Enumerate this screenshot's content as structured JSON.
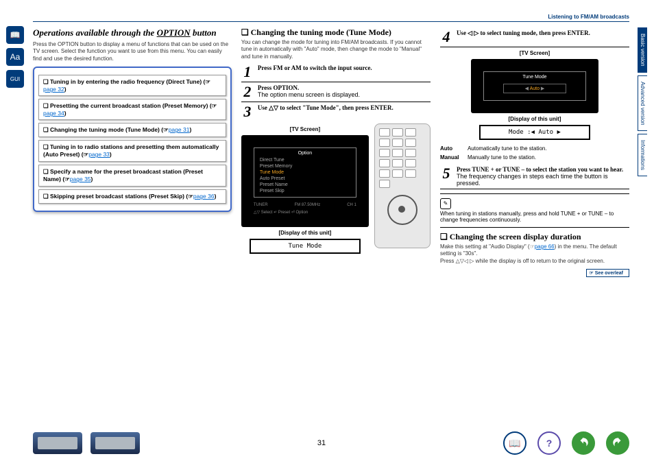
{
  "breadcrumb": "Listening to FM/AM broadcasts",
  "sideTabs": {
    "basic": "Basic version",
    "advanced": "Advanced version",
    "info": "Informations"
  },
  "sec1": {
    "title_a": "Operations available through the ",
    "title_b": "OPTION",
    "title_c": " button",
    "intro": "Press the OPTION button to display a menu of functions that can be used on the TV screen. Select the function you want to use from this menu. You can easily find and use the desired function.",
    "items": [
      {
        "t": "❏ Tuning in by entering the radio frequency (Direct Tune) (☞",
        "pg": "page 32",
        "close": ")"
      },
      {
        "t": "❏ Presetting the current broadcast station (Preset Memory) (☞",
        "pg": "page 34",
        "close": ")"
      },
      {
        "t": "❏ Changing the tuning mode (Tune Mode) (☞",
        "pg": "page 31",
        "close": ")"
      },
      {
        "t": "❏ Tuning in to radio stations and presetting them automatically (Auto Preset) (☞",
        "pg": "page 33",
        "close": ")"
      },
      {
        "t": "❏ Specify a name for the preset broadcast station (Preset Name) (☞",
        "pg": "page 35",
        "close": ")"
      },
      {
        "t": "❏ Skipping preset broadcast stations (Preset Skip) (☞",
        "pg": "page 36",
        "close": ")"
      }
    ]
  },
  "sec2": {
    "title": "❏ Changing the tuning mode (Tune Mode)",
    "intro": "You can change the mode for tuning into FM/AM broadcasts. If you cannot tune in automatically with \"Auto\" mode, then change the mode to \"Manual\" and tune in manually.",
    "step1": "Press FM or AM to switch the input source.",
    "step2": "Press OPTION.",
    "step2b": "The option menu screen is displayed.",
    "step3": "Use △▽ to select \"Tune Mode\", then press ENTER.",
    "tvLabel": "[TV Screen]",
    "dispLabel": "[Display of this unit]",
    "menu": {
      "title": "Option",
      "items": [
        "Direct Tune",
        "Preset Memory",
        "Tune Mode",
        "Auto Preset",
        "Preset Name",
        "Preset Skip"
      ],
      "sel": 2,
      "stat_l": "TUNER",
      "stat_m": "FM  87.50MHz",
      "foot": "△▽ Select   ↵ Preset   ⏎ Option"
    },
    "lcd1": "Tune Mode"
  },
  "sec3": {
    "step4": "Use ◁ ▷ to select tuning mode, then press ENTER.",
    "tvLabel": "[TV Screen]",
    "menu2": {
      "title": "Tune Mode",
      "val": "Auto"
    },
    "dispLabel": "[Display of this unit]",
    "lcd2": "Mode    :◀ Auto ▶",
    "tbl": [
      {
        "k": "Auto",
        "v": "Automatically tune to the station."
      },
      {
        "k": "Manual",
        "v": "Manually tune to the station."
      }
    ],
    "step5": "Press TUNE + or TUNE – to select the station you want to hear.",
    "step5b": "The frequency changes in steps each time the button is pressed.",
    "note": "When tuning in stations manually, press and hold TUNE + or TUNE – to change frequencies continuously.",
    "sec4title": "❏ Changing the screen display duration",
    "sec4_a": "Make this setting at \"Audio Display\" (☞",
    "sec4_pg": "page 66",
    "sec4_b": ") in the menu. The default setting is \"30s\".",
    "sec4_c": "Press △▽◁ ▷ while the display is off to return to the original screen.",
    "overleaf": "☞ See overleaf"
  },
  "pageNumber": "31"
}
